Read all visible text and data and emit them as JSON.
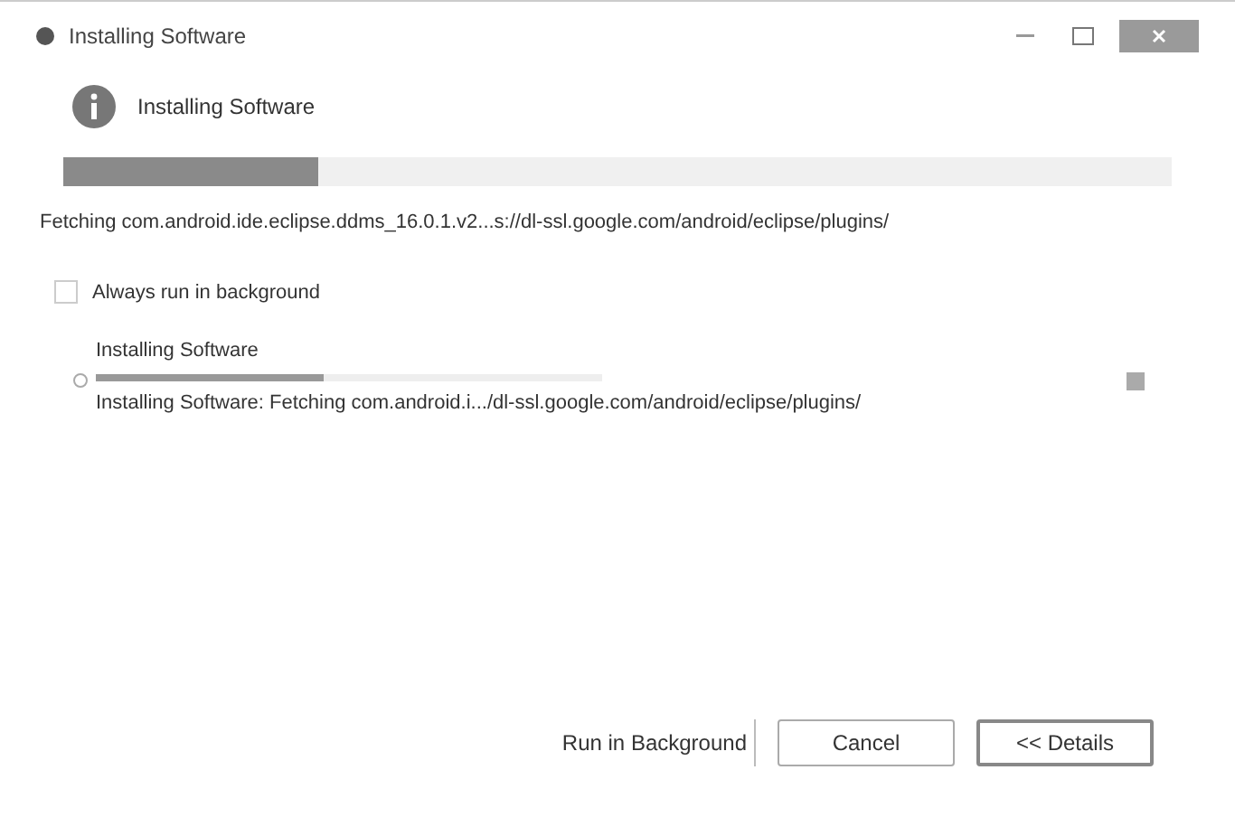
{
  "window": {
    "title": "Installing Software"
  },
  "header": {
    "title": "Installing Software"
  },
  "progress": {
    "level": 0.23
  },
  "status": "Fetching com.android.ide.eclipse.ddms_16.0.1.v2...s://dl-ssl.google.com/android/eclipse/plugins/",
  "always_run_in_background": {
    "label": "Always run in background",
    "checked": false
  },
  "job": {
    "name": "Installing Software",
    "level": 0.45,
    "detail": "Installing Software: Fetching com.android.i.../dl-ssl.google.com/android/eclipse/plugins/"
  },
  "buttons": [
    {
      "label": "Run in Background",
      "kind": "flat"
    },
    {
      "label": "Cancel",
      "kind": "normal"
    },
    {
      "label": "<< Details",
      "kind": "default"
    }
  ]
}
